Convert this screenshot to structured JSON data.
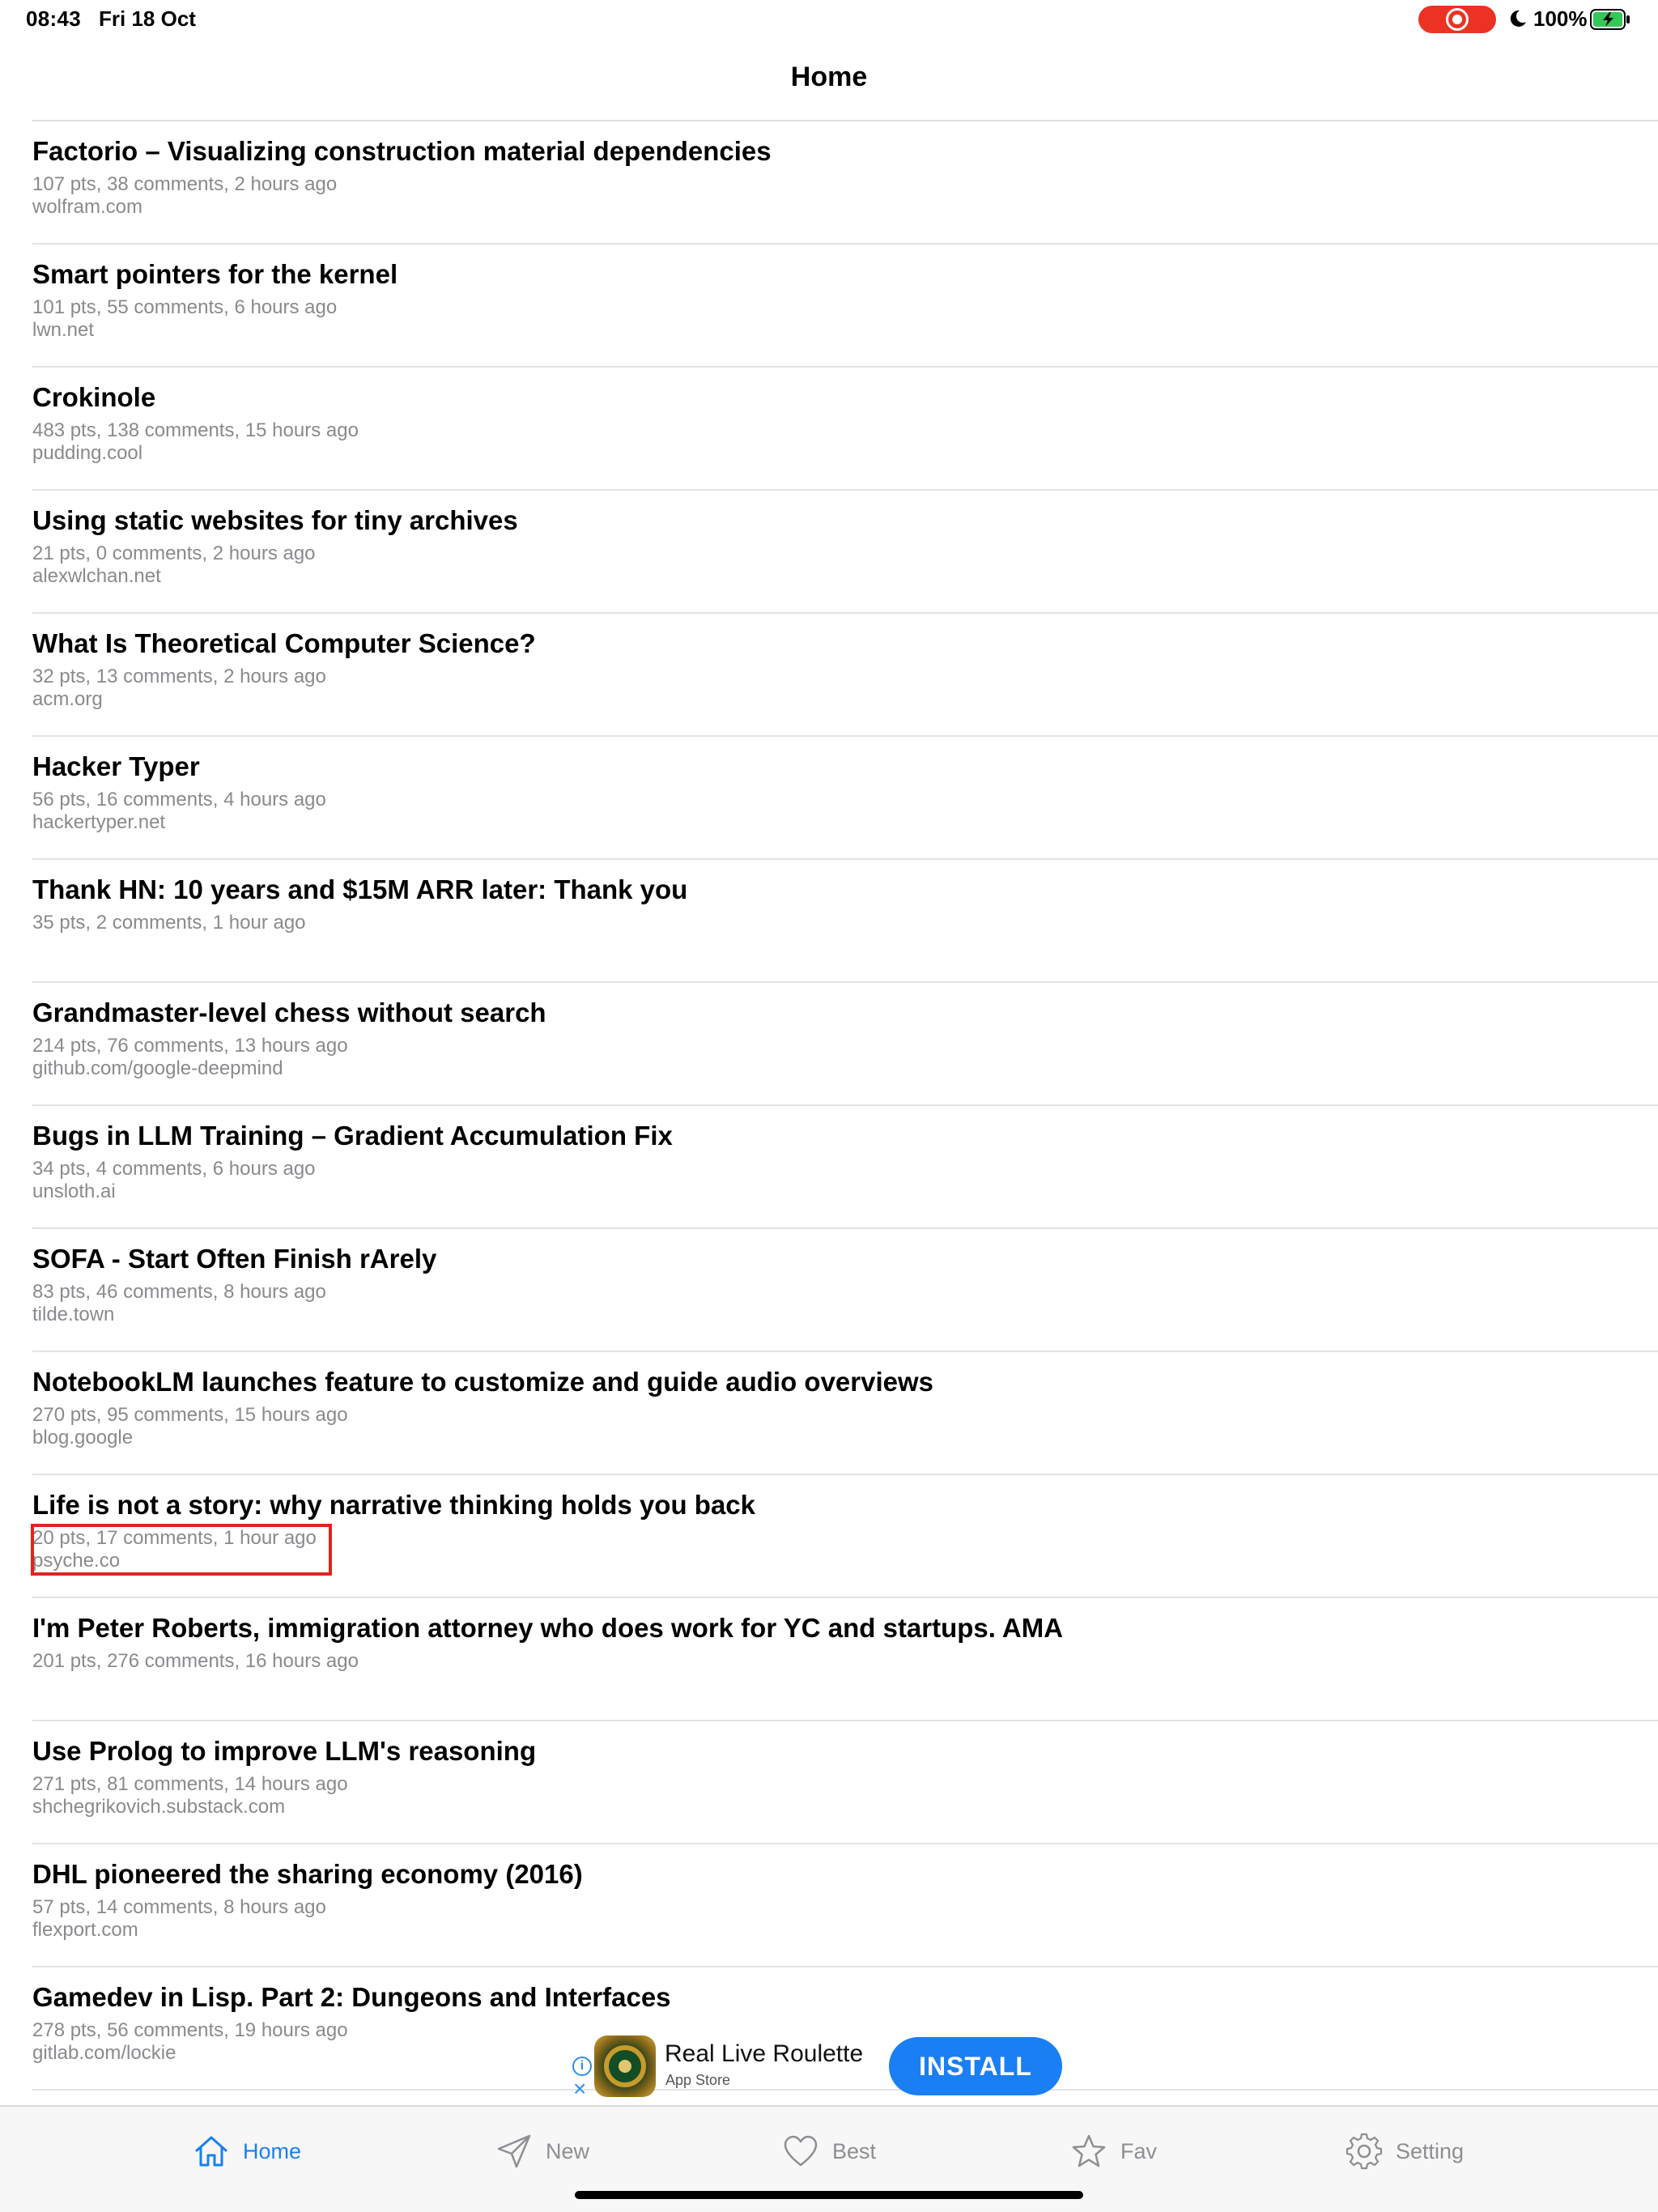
{
  "status_bar": {
    "time": "08:43",
    "date": "Fri 18 Oct",
    "battery_percent": "100%"
  },
  "nav": {
    "title": "Home"
  },
  "stories": [
    {
      "title": "Factorio – Visualizing construction material dependencies",
      "meta": "107 pts, 38 comments, 2 hours ago",
      "domain": "wolfram.com"
    },
    {
      "title": "Smart pointers for the kernel",
      "meta": "101 pts, 55 comments, 6 hours ago",
      "domain": "lwn.net"
    },
    {
      "title": "Crokinole",
      "meta": "483 pts, 138 comments, 15 hours ago",
      "domain": "pudding.cool"
    },
    {
      "title": "Using static websites for tiny archives",
      "meta": "21 pts, 0 comments, 2 hours ago",
      "domain": "alexwlchan.net"
    },
    {
      "title": "What Is Theoretical Computer Science?",
      "meta": "32 pts, 13 comments, 2 hours ago",
      "domain": "acm.org"
    },
    {
      "title": "Hacker Typer",
      "meta": "56 pts, 16 comments, 4 hours ago",
      "domain": "hackertyper.net"
    },
    {
      "title": "Thank HN: 10 years and $15M ARR later: Thank you",
      "meta": "35 pts, 2 comments, 1 hour ago",
      "domain": ""
    },
    {
      "title": "Grandmaster-level chess without search",
      "meta": "214 pts, 76 comments, 13 hours ago",
      "domain": "github.com/google-deepmind"
    },
    {
      "title": "Bugs in LLM Training – Gradient Accumulation Fix",
      "meta": "34 pts, 4 comments, 6 hours ago",
      "domain": "unsloth.ai"
    },
    {
      "title": "SOFA - Start Often Finish rArely",
      "meta": "83 pts, 46 comments, 8 hours ago",
      "domain": "tilde.town"
    },
    {
      "title": "NotebookLM launches feature to customize and guide audio overviews",
      "meta": "270 pts, 95 comments, 15 hours ago",
      "domain": "blog.google"
    },
    {
      "title": "Life is not a story: why narrative thinking holds you back",
      "meta": "20 pts, 17 comments, 1 hour ago",
      "domain": "psyche.co"
    },
    {
      "title": "I'm Peter Roberts, immigration attorney who does work for YC and startups. AMA",
      "meta": "201 pts, 276 comments, 16 hours ago",
      "domain": ""
    },
    {
      "title": "Use Prolog to improve LLM's reasoning",
      "meta": "271 pts, 81 comments, 14 hours ago",
      "domain": "shchegrikovich.substack.com"
    },
    {
      "title": "DHL pioneered the sharing economy (2016)",
      "meta": "57 pts, 14 comments, 8 hours ago",
      "domain": "flexport.com"
    },
    {
      "title": "Gamedev in Lisp. Part 2: Dungeons and Interfaces",
      "meta": "278 pts, 56 comments, 19 hours ago",
      "domain": "gitlab.com/lockie"
    }
  ],
  "ad": {
    "title": "Real Live Roulette",
    "subtitle": "App Store",
    "button": "INSTALL",
    "info_icon": "info-icon",
    "close_icon": "close-icon"
  },
  "tab_bar": {
    "tabs": [
      {
        "label": "Home",
        "icon": "house-icon",
        "active": true
      },
      {
        "label": "New",
        "icon": "paper-plane-icon",
        "active": false
      },
      {
        "label": "Best",
        "icon": "heart-icon",
        "active": false
      },
      {
        "label": "Fav",
        "icon": "star-icon",
        "active": false
      },
      {
        "label": "Setting",
        "icon": "gear-icon",
        "active": false
      }
    ]
  },
  "colors": {
    "accent": "#1a7ff2",
    "meta_text": "#8a8a8e",
    "highlight": "#e1231f",
    "record": "#ea3323",
    "battery": "#34c759"
  }
}
